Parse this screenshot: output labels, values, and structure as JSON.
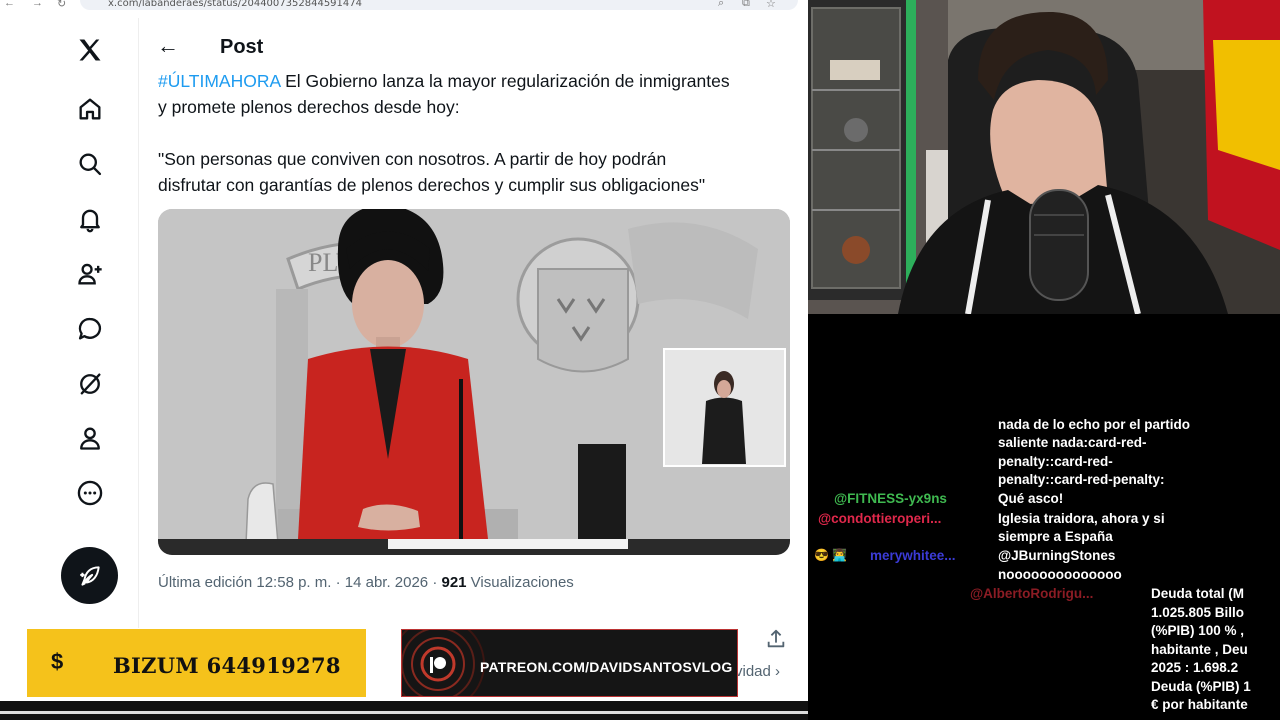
{
  "browser": {
    "url": "x.com/labanderaes/status/2044007352844591474"
  },
  "nav": {
    "items": [
      "x-logo",
      "home",
      "explore",
      "notifications",
      "follow",
      "messages",
      "grok",
      "profile",
      "more"
    ]
  },
  "post": {
    "header_title": "Post",
    "hashtag": "#ÚLTIMAHORA",
    "text_line1": " El Gobierno lanza la mayor regularización de inmigrantes",
    "text_line2": "y promete plenos derechos desde hoy:",
    "quote_line1": "\"Son personas que conviven con nosotros. A partir de hoy podrán",
    "quote_line2": "disfrutar con garantías de plenos derechos y cumplir sus obligaciones\"",
    "media_backdrop_text": "PLVS",
    "meta_prefix": "Última edición 12:58 p. m. · 14 abr. 2026 · ",
    "views_count": "921",
    "views_label": " Visualizaciones",
    "activity_label": "vidad ›"
  },
  "overlays": {
    "bizum_label": "BIZUM 644919278",
    "bizum_symbol": "$",
    "patreon_label": "PATREON.COM/DAVIDSANTOSVLOG"
  },
  "chat": {
    "continued_message": [
      "nada de lo echo por el partido",
      "saliente nada:card-red-",
      "penalty::card-red-",
      "penalty::card-red-penalty:"
    ],
    "messages": [
      {
        "user": "@FITNESS-yx9ns",
        "color": "#3fb950",
        "text": [
          "Qué asco!"
        ]
      },
      {
        "user": "@condottieroperi...",
        "color": "#e0284b",
        "text": [
          "Iglesia traidora, ahora y si",
          "siempre a España"
        ]
      },
      {
        "user": "merywhitee...",
        "color": "#3b3bd6",
        "badges": "😎 👨‍💻",
        "text": [
          "@JBurningStones",
          "noooooooooooooo"
        ]
      },
      {
        "user": "@AlbertoRodrigu...",
        "color": "#8b1c24",
        "text": []
      }
    ],
    "deuda_lines": [
      "Deuda total (M",
      "1.025.805 Billo",
      "(%PIB) 100 % ,",
      "habitante , Deu",
      "2025 : 1.698.2",
      "Deuda (%PIB) 1",
      "€ por habitante"
    ]
  },
  "colors": {
    "x_blue": "#1d9bf0",
    "bizum_yellow": "#f5c21b",
    "blazer_red": "#c8241f"
  }
}
